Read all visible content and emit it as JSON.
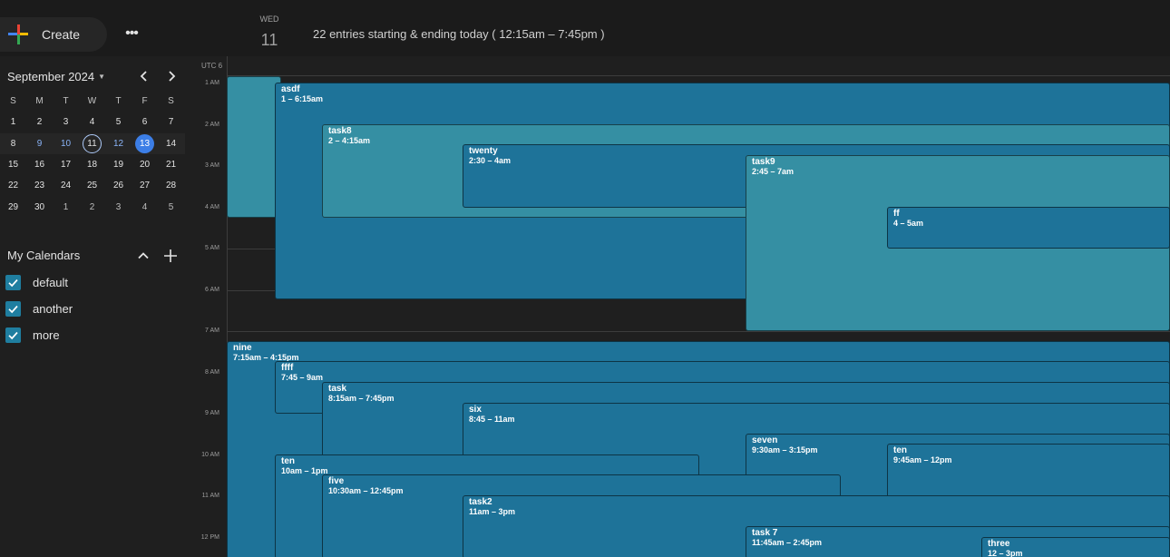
{
  "header": {
    "create_label": "Create",
    "more_label": "•••",
    "day_of_week": "WED",
    "day_number": "11",
    "summary": "22 entries starting & ending today ( 12:15am – 7:45pm )"
  },
  "minical": {
    "month_label": "September 2024",
    "weekdays": [
      "S",
      "M",
      "T",
      "W",
      "T",
      "F",
      "S"
    ],
    "weeks": [
      [
        "1",
        "2",
        "3",
        "4",
        "5",
        "6",
        "7"
      ],
      [
        "8",
        "9",
        "10",
        "11",
        "12",
        "13",
        "14"
      ],
      [
        "15",
        "16",
        "17",
        "18",
        "19",
        "20",
        "21"
      ],
      [
        "22",
        "23",
        "24",
        "25",
        "26",
        "27",
        "28"
      ],
      [
        "29",
        "30",
        "1",
        "2",
        "3",
        "4",
        "5"
      ]
    ]
  },
  "calendars": {
    "heading": "My Calendars",
    "items": [
      {
        "label": "default"
      },
      {
        "label": "another"
      },
      {
        "label": "more"
      }
    ]
  },
  "grid": {
    "timezone": "UTC 6",
    "hours": [
      "1 AM",
      "2 AM",
      "3 AM",
      "4 AM",
      "5 AM",
      "6 AM",
      "7 AM",
      "8 AM",
      "9 AM",
      "10 AM",
      "11 AM",
      "12 PM"
    ]
  },
  "events": [
    {
      "title": "",
      "time": ""
    },
    {
      "title": "asdf",
      "time": "1 – 6:15am"
    },
    {
      "title": "task8",
      "time": "2 – 4:15am"
    },
    {
      "title": "twenty",
      "time": "2:30 – 4am"
    },
    {
      "title": "task9",
      "time": "2:45 – 7am"
    },
    {
      "title": "ff",
      "time": "4 – 5am"
    },
    {
      "title": "nine",
      "time": "7:15am – 4:15pm"
    },
    {
      "title": "ffff",
      "time": "7:45 – 9am"
    },
    {
      "title": "task",
      "time": "8:15am – 7:45pm"
    },
    {
      "title": "six",
      "time": "8:45 – 11am"
    },
    {
      "title": "seven",
      "time": "9:30am – 3:15pm"
    },
    {
      "title": "ten",
      "time": "9:45am – 12pm"
    },
    {
      "title": "ten",
      "time": "10am – 1pm"
    },
    {
      "title": "five",
      "time": "10:30am – 12:45pm"
    },
    {
      "title": "task2",
      "time": "11am – 3pm"
    },
    {
      "title": "task 7",
      "time": "11:45am – 2:45pm"
    },
    {
      "title": "three",
      "time": "12 – 3pm"
    }
  ],
  "colors": {
    "event_dark": "#1e7399",
    "event_light": "#358fa3",
    "selected_day": "#3c7ee6",
    "checkbox": "#1f7ea0"
  }
}
